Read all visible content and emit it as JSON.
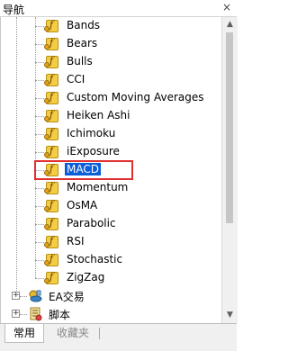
{
  "panel": {
    "title": "导航",
    "close_glyph": "×"
  },
  "indicators": [
    "Bands",
    "Bears",
    "Bulls",
    "CCI",
    "Custom Moving Averages",
    "Heiken Ashi",
    "Ichimoku",
    "iExposure",
    "MACD",
    "Momentum",
    "OsMA",
    "Parabolic",
    "RSI",
    "Stochastic",
    "ZigZag"
  ],
  "selected_indicator": "MACD",
  "nodes": [
    {
      "label": "EA交易",
      "icon": "expert-advisor-icon",
      "expander": "+"
    },
    {
      "label": "脚本",
      "icon": "script-icon",
      "expander": "+"
    }
  ],
  "scrollbar": {
    "up": "▲",
    "down": "▼"
  },
  "tabs": {
    "common": "常用",
    "favorites": "收藏夹"
  },
  "colors": {
    "selection": "#0b5ed7",
    "highlight_box": "#e03131",
    "indicator_icon": "#f4cd44"
  }
}
